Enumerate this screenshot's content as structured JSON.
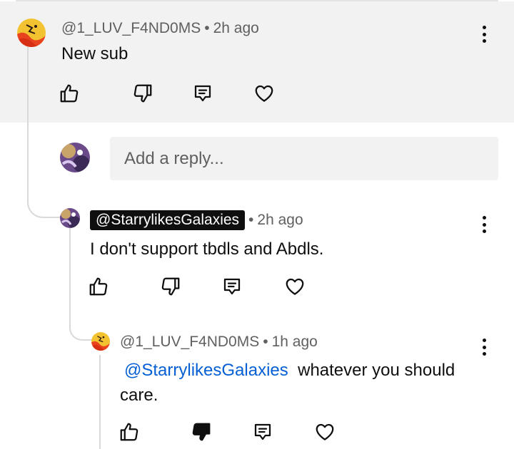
{
  "comment1": {
    "handle": "@1_LUV_F4ND0MS",
    "time": "2h ago",
    "text": "New sub"
  },
  "reply_box": {
    "placeholder": "Add a reply..."
  },
  "comment2": {
    "handle": "@StarrylikesGalaxies",
    "time": "2h ago",
    "text": "I don't support tbdls and Abdls."
  },
  "comment3": {
    "handle": "@1_LUV_F4ND0MS",
    "time": "1h ago",
    "mention": "@StarrylikesGalaxies",
    "text_line1": "whatever you should",
    "text_line2": "care."
  },
  "separator": "•",
  "icons": {
    "like": "thumbs-up-icon",
    "dislike": "thumbs-down-icon",
    "reply": "reply-comment-icon",
    "heart": "heart-icon",
    "more": "more-vert-icon"
  },
  "colors": {
    "highlight_bg": "#f2f2f2",
    "mention": "#065fd4",
    "meta_text": "#606060",
    "chip_bg": "#0f0f0f"
  }
}
